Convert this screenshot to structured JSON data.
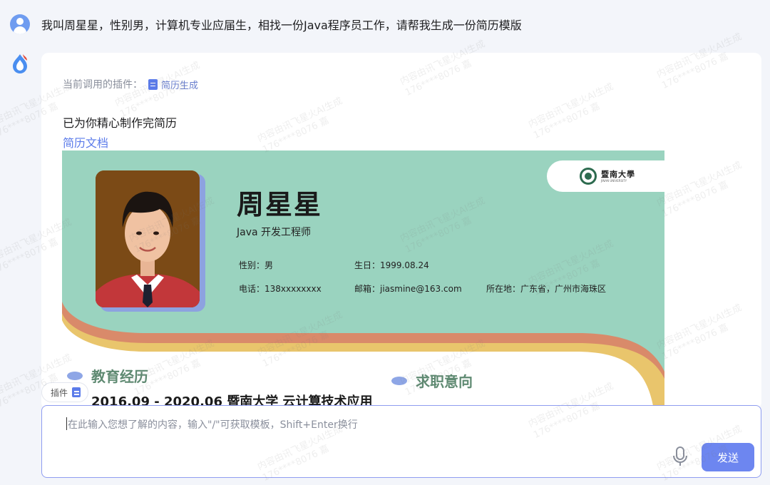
{
  "conversation": {
    "user_message": "我叫周星星，性别男，计算机专业应届生，相找一份Java程序员工作，请帮我生成一份简历模版",
    "plugin_prefix": "当前调用的插件：",
    "plugin_name": "简历生成",
    "done_text": "已为你精心制作完简历",
    "doc_link": "简历文档"
  },
  "resume": {
    "university_cn": "暨南大學",
    "university_en": "JINAN UNIVERSITY",
    "name": "周星星",
    "title": "Java 开发工程师",
    "gender": "性别：男",
    "birthday": "生日：1999.08.24",
    "phone": "电话：138xxxxxxxx",
    "email": "邮箱：jiasmine@163.com",
    "location": "所在地：广东省，广州市海珠区",
    "section_education": "教育经历",
    "section_job_intent": "求职意向",
    "education_line": "2016.09 - 2020.06 暨南大学 云计算技术应用"
  },
  "composer": {
    "plugin_tag": "插件",
    "placeholder": "在此输入您想了解的内容，输入\"/\"可获取模板，Shift+Enter换行",
    "send_label": "发送"
  },
  "watermark": {
    "line1": "内容由讯飞星火AI生成",
    "line2": "176****8076 嘉"
  },
  "colors": {
    "resume_mint": "#9ad3bf",
    "resume_orange": "#d98a6a",
    "resume_yellow": "#e9c56c",
    "accent_blue": "#5b7bea",
    "send_button": "#6d86f0"
  }
}
